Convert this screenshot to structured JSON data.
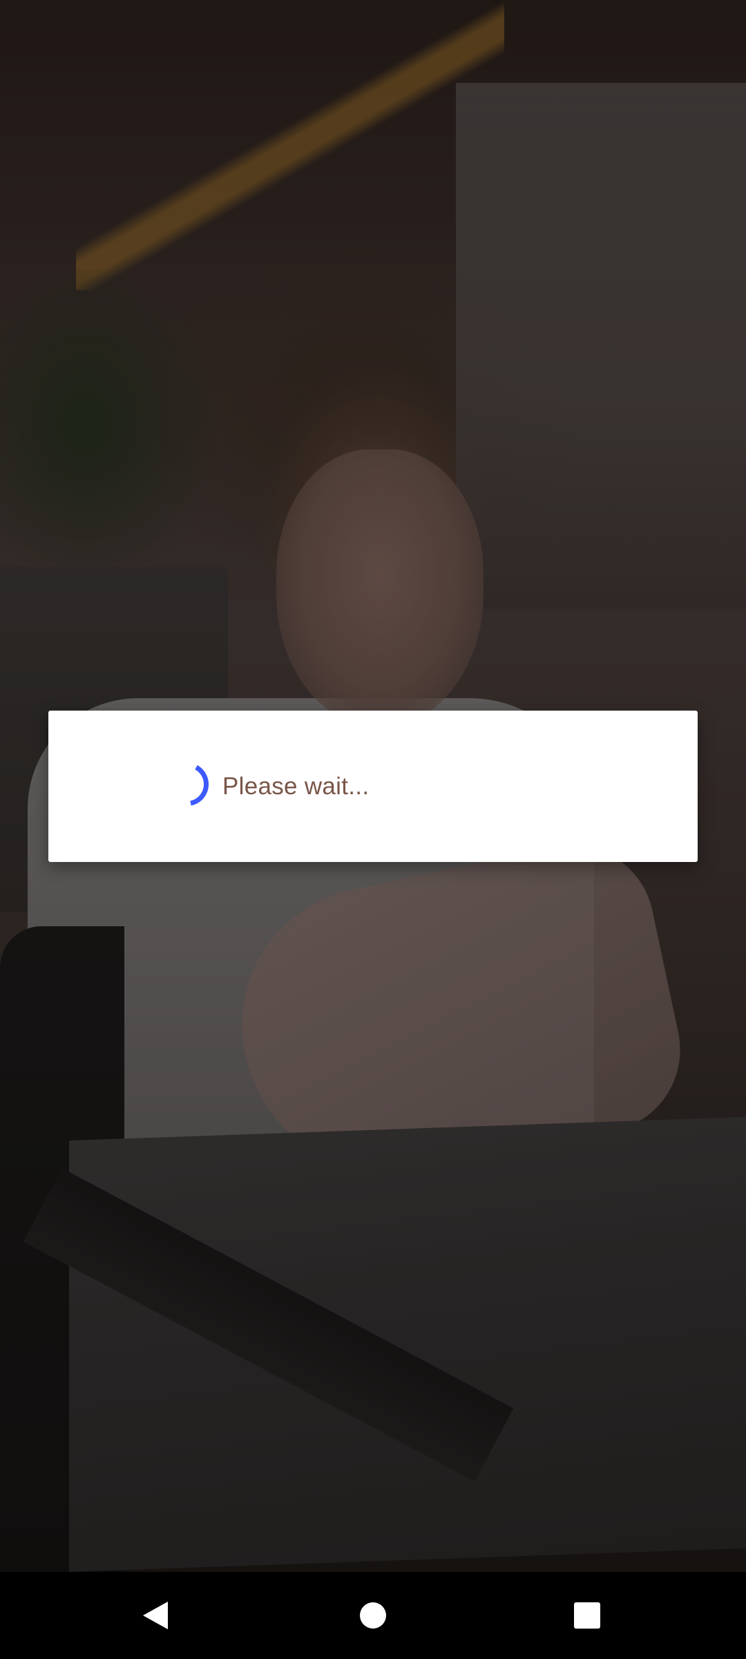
{
  "dialog": {
    "message": "Please wait..."
  },
  "icons": {
    "spinner": "progress-spinner-icon",
    "back": "back-triangle-icon",
    "home": "home-circle-icon",
    "recents": "recents-square-icon"
  },
  "colors": {
    "spinner": "#3d5afe",
    "message_text": "#795548",
    "dialog_background": "#ffffff",
    "navbar_background": "#000000",
    "nav_icons": "#ffffff"
  }
}
